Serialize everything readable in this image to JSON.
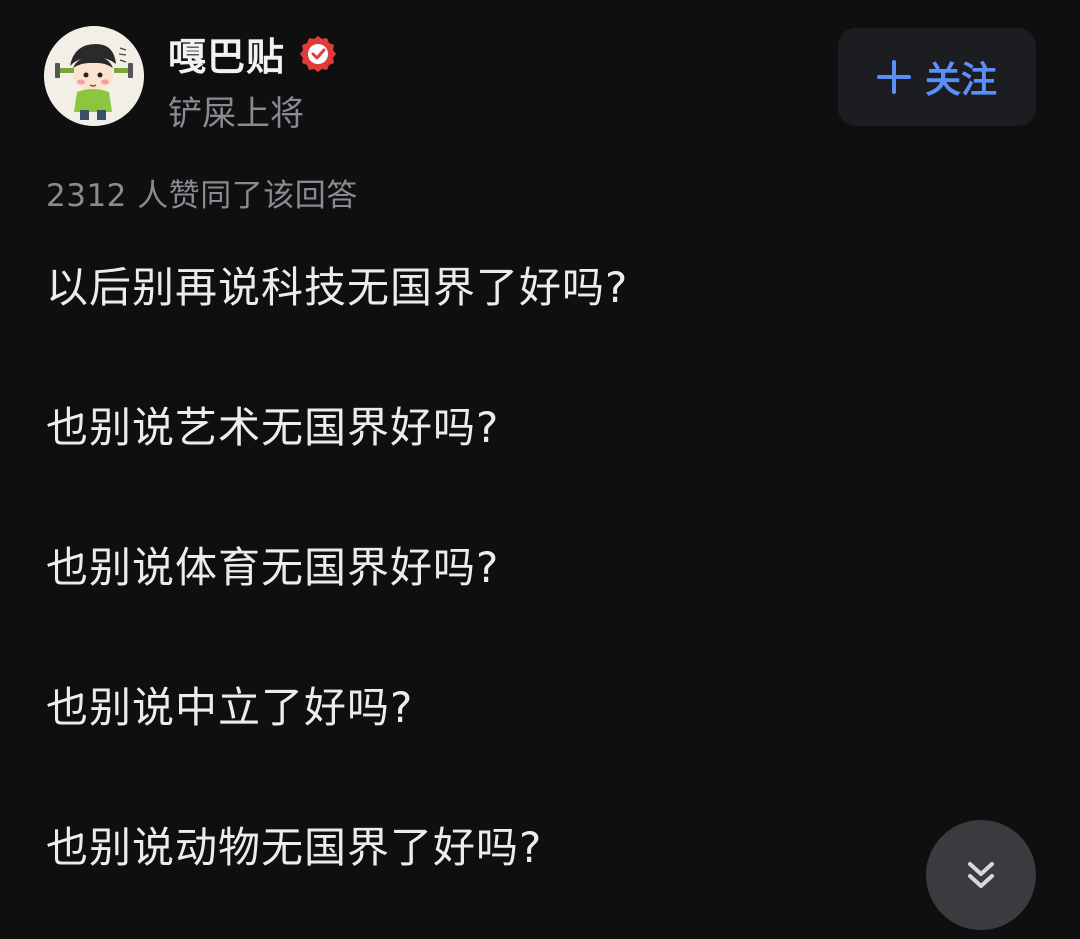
{
  "author": {
    "name": "嘎巴贴",
    "title": "铲屎上将",
    "avatar_icon": "cartoon-boy-avatar",
    "verified_icon": "verified-check-badge"
  },
  "follow_button": {
    "label": "关注",
    "icon": "plus-icon",
    "accent_color": "#5a8ef8"
  },
  "answer": {
    "likes_text": "2312 人赞同了该回答",
    "paragraphs": [
      "以后别再说科技无国界了好吗?",
      "也别说艺术无国界好吗?",
      "也别说体育无国界好吗?",
      "也别说中立了好吗?",
      "也别说动物无国界了好吗?"
    ]
  },
  "scroll_button": {
    "icon": "double-chevron-down-icon"
  },
  "colors": {
    "background": "#0f0f10",
    "text_primary": "#ececef",
    "text_secondary": "#8a8a92",
    "verified_red": "#e03b3b"
  }
}
